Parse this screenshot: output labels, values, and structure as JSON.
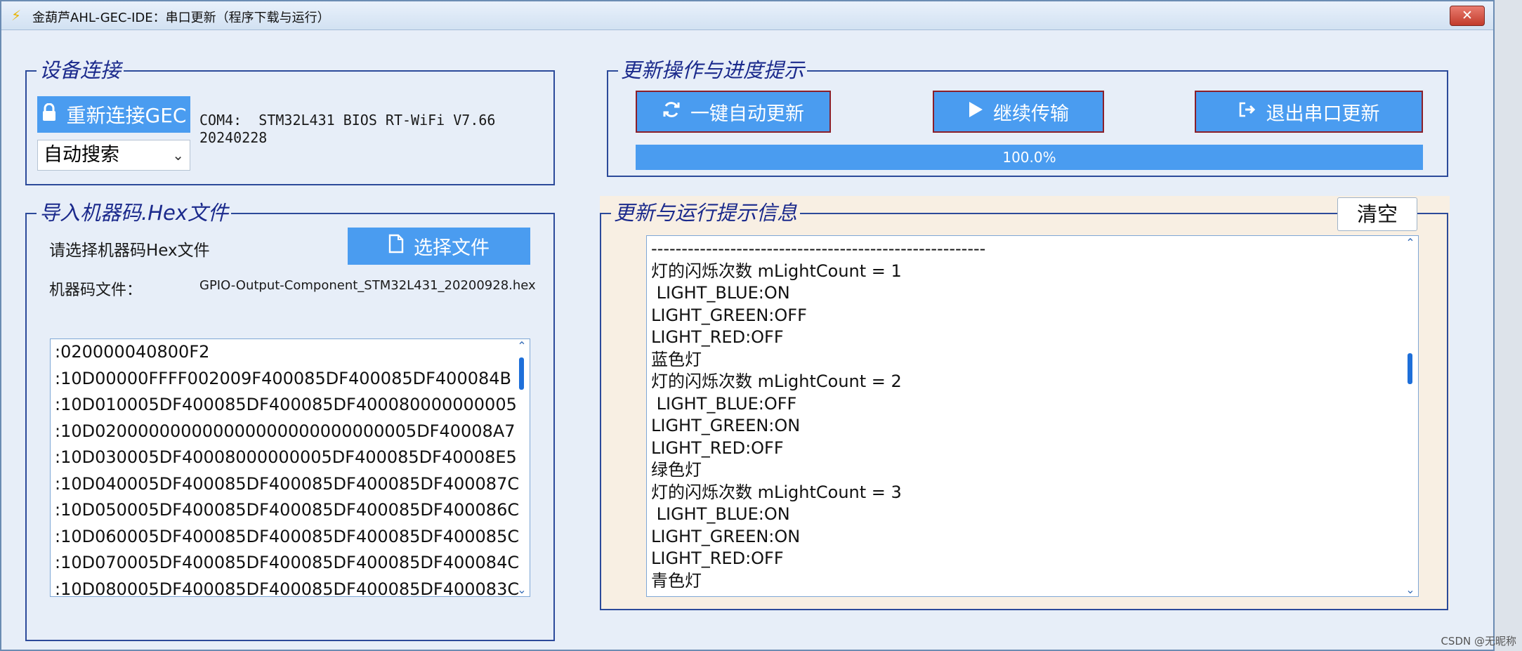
{
  "window": {
    "title": "金葫芦AHL-GEC-IDE：串口更新（程序下载与运行）",
    "close_label": "✕"
  },
  "device": {
    "legend": "设备连接",
    "reconnect_label": "重新连接GEC",
    "port_info_line1": "COM4:  STM32L431 BIOS RT-WiFi V7.66",
    "port_info_line2": "20240228",
    "search_mode": "自动搜索"
  },
  "import": {
    "legend": "导入机器码.Hex文件",
    "prompt": "请选择机器码Hex文件",
    "choose_label": "选择文件",
    "file_label": "机器码文件：",
    "file_name": "GPIO-Output-Component_STM32L431_20200928.hex",
    "hex_lines": [
      ":020000040800F2",
      ":10D00000FFFF002009F400085DF400085DF400084B",
      ":10D010005DF400085DF400085DF400080000000005",
      ":10D020000000000000000000000000005DF40008A7",
      ":10D030005DF40008000000005DF400085DF40008E5",
      ":10D040005DF400085DF400085DF400085DF400087C",
      ":10D050005DF400085DF400085DF400085DF400086C",
      ":10D060005DF400085DF400085DF400085DF400085C",
      ":10D070005DF400085DF400085DF400085DF400084C",
      ":10D080005DF400085DF400085DF400085DF400083C"
    ]
  },
  "update": {
    "legend": "更新操作与进度提示",
    "auto_update_label": "一键自动更新",
    "continue_label": "继续传输",
    "exit_label": "退出串口更新",
    "progress_text": "100.0%",
    "progress_fraction": 1.0
  },
  "log": {
    "legend": "更新与运行提示信息",
    "clear_label": "清空",
    "lines": [
      "-------------------------------------------------------",
      "灯的闪烁次数 mLightCount = 1",
      " LIGHT_BLUE:ON",
      "LIGHT_GREEN:OFF",
      "LIGHT_RED:OFF",
      "蓝色灯",
      "灯的闪烁次数 mLightCount = 2",
      " LIGHT_BLUE:OFF",
      "LIGHT_GREEN:ON",
      "LIGHT_RED:OFF",
      "绿色灯",
      "灯的闪烁次数 mLightCount = 3",
      " LIGHT_BLUE:ON",
      "LIGHT_GREEN:ON",
      "LIGHT_RED:OFF",
      "青色灯"
    ]
  },
  "watermark": "CSDN @无昵称",
  "colors": {
    "button_blue": "#4a9cf0",
    "legend_navy": "#1b2a8c",
    "group_border": "#2c4a9a",
    "button_border_red": "#8a1f2a",
    "log_panel_bg": "#f8efe3"
  },
  "icons": {
    "reconnect": "lock-icon",
    "choose_file": "file-icon",
    "auto_update": "refresh-icon",
    "continue": "play-icon",
    "exit": "exit-icon",
    "window": "lightning-icon",
    "close": "close-icon",
    "dropdown": "chevron-down-icon"
  }
}
